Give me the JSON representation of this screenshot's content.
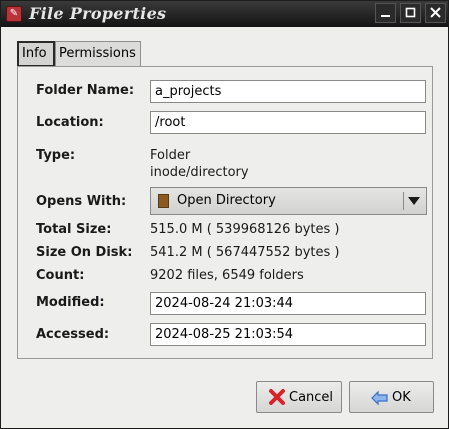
{
  "window": {
    "title": "File Properties"
  },
  "tabs": [
    {
      "label": "Info",
      "active": true
    },
    {
      "label": "Permissions",
      "active": false
    }
  ],
  "fields": {
    "folder_name": {
      "label": "Folder Name:",
      "value": "a_projects"
    },
    "location": {
      "label": "Location:",
      "value": "/root"
    },
    "type": {
      "label": "Type:",
      "value": "Folder",
      "mime": "inode/directory"
    },
    "opens_with": {
      "label": "Opens With:",
      "value": "Open Directory"
    },
    "total_size": {
      "label": "Total Size:",
      "value": "515.0 M ( 539968126 bytes )"
    },
    "size_on_disk": {
      "label": "Size On Disk:",
      "value": "541.2 M ( 567447552 bytes )"
    },
    "count": {
      "label": "Count:",
      "value": "9202 files, 6549 folders"
    },
    "modified": {
      "label": "Modified:",
      "value": "2024-08-24 21:03:44"
    },
    "accessed": {
      "label": "Accessed:",
      "value": "2024-08-25 21:03:54"
    }
  },
  "buttons": {
    "cancel": "Cancel",
    "ok": "OK"
  },
  "colors": {
    "titlebar": "#1e1e1e",
    "background": "#eeeeec",
    "cancel_icon": "#d8222a",
    "ok_icon": "#3a6fc8"
  },
  "icons": {
    "app": "file-properties-icon",
    "minimize": "minimize-icon",
    "maximize": "maximize-icon",
    "close": "close-icon",
    "opens_with": "folder-app-icon",
    "cancel": "cancel-x-icon",
    "ok": "ok-arrow-icon"
  }
}
